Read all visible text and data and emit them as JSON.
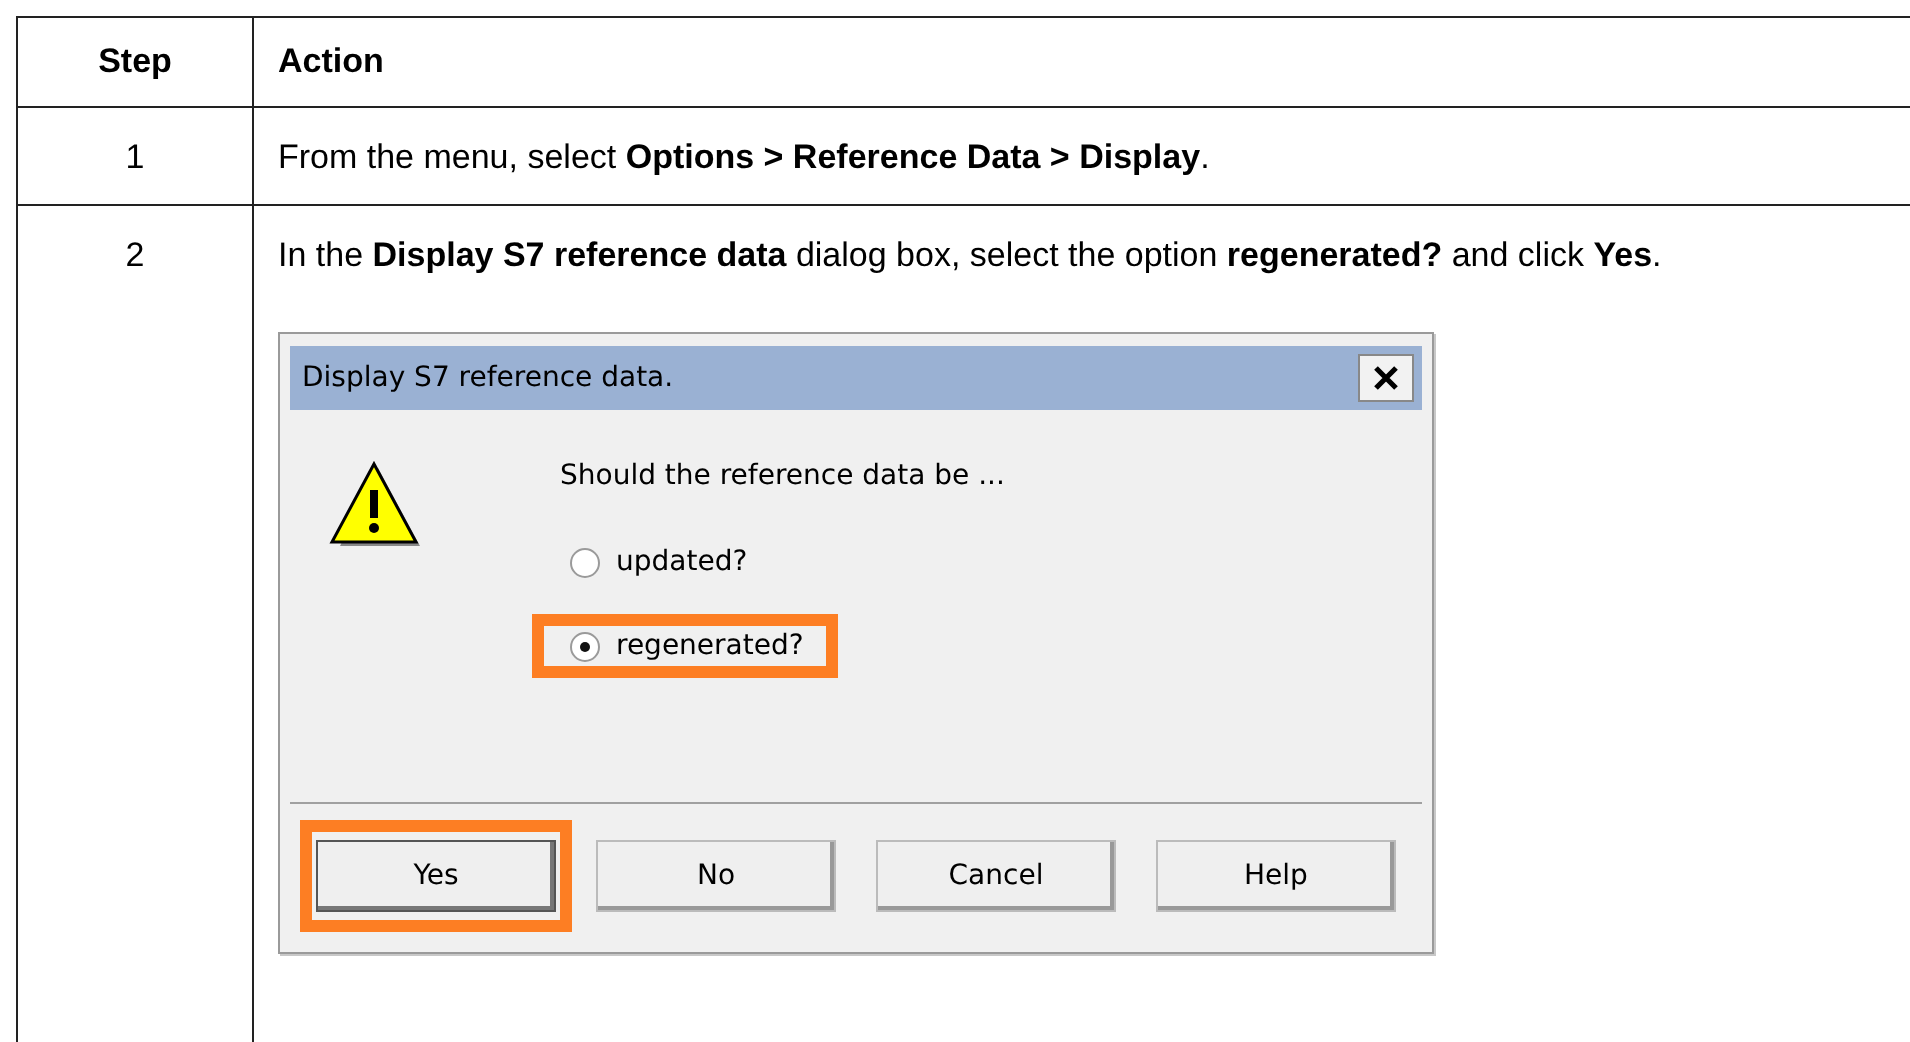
{
  "table": {
    "columns": [
      "Step",
      "Action"
    ],
    "rows": [
      {
        "step": "1",
        "action": "From the menu, select **Options > Reference Data > Display**."
      },
      {
        "step": "2",
        "action": "In the **Display S7 reference data** dialog box, select the option **regenerated?** and click **Yes**.",
        "dialog": {
          "title": "Display S7 reference data.",
          "message": "Should the reference data be ...",
          "options": [
            {
              "label": "updated?",
              "selected": false,
              "highlighted": false
            },
            {
              "label": "regenerated?",
              "selected": true,
              "highlighted": true
            }
          ],
          "buttons": [
            {
              "label": "Yes",
              "default": true,
              "highlighted": true
            },
            {
              "label": "No",
              "default": false,
              "highlighted": false
            },
            {
              "label": "Cancel",
              "default": false,
              "highlighted": false
            },
            {
              "label": "Help",
              "default": false,
              "highlighted": false
            }
          ]
        }
      }
    ]
  }
}
